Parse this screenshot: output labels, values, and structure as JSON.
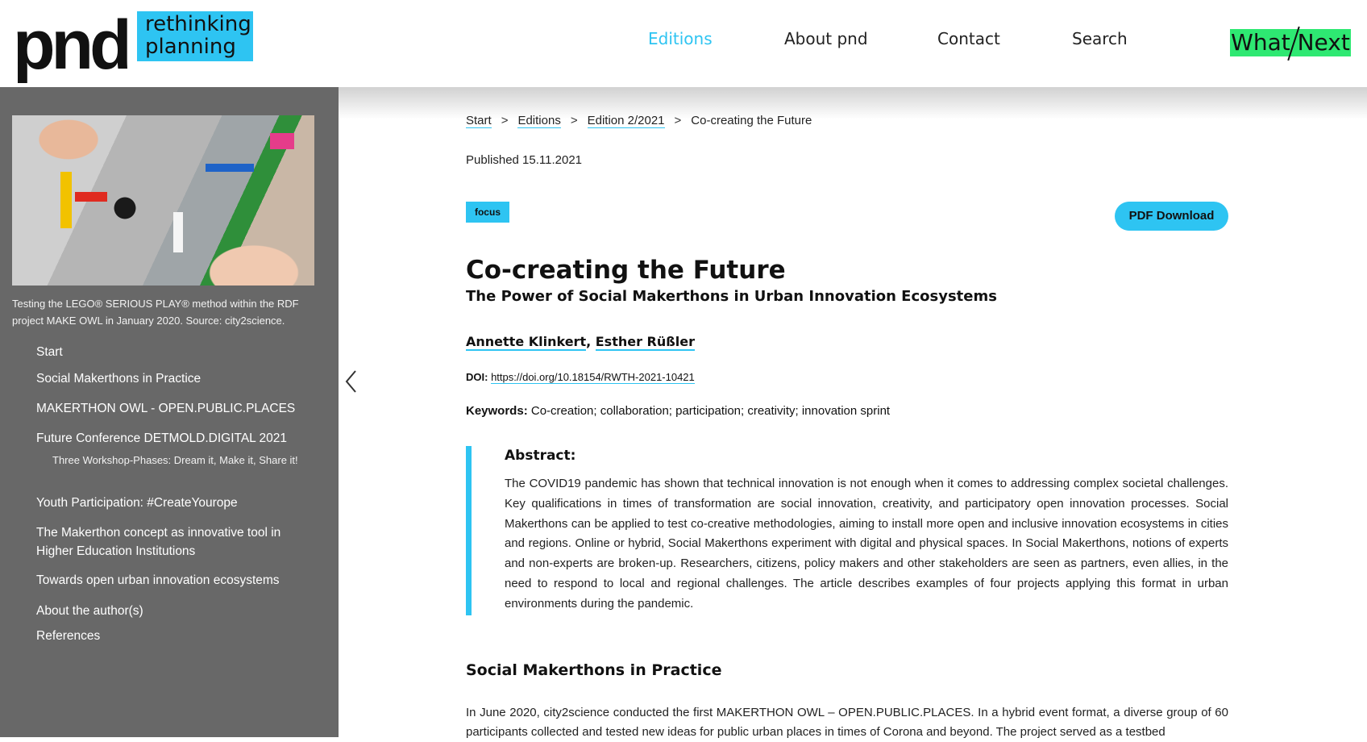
{
  "header": {
    "logo_main": "pnd",
    "logo_box_line1": "rethinking",
    "logo_box_line2": "planning",
    "nav": [
      {
        "label": "Editions",
        "active": true
      },
      {
        "label": "About pnd"
      },
      {
        "label": "Contact"
      },
      {
        "label": "Search"
      }
    ],
    "whatnext": "What Next",
    "accent": "#2ec4f2",
    "whatnext_color": "#2ee872"
  },
  "sidebar": {
    "image_alt": "LEGO SERIOUS PLAY workshop photo",
    "caption": "Testing the LEGO® SERIOUS PLAY® method within the RDF project MAKE OWL in January 2020. Source: city2science.",
    "toc": [
      "Start",
      "Social Makerthons in Practice",
      "MAKERTHON OWL - OPEN.PUBLIC.PLACES",
      "Future Conference DETMOLD.DIGITAL 2021",
      "Youth Participation: #CreateYourope",
      "The Makerthon concept as innovative tool in Higher Education Institutions",
      "Towards open urban innovation ecosystems",
      "About the author(s)",
      "References"
    ],
    "toc_sub": "Three Workshop-Phases: Dream it, Make it, Share it!",
    "background": "#686868"
  },
  "article": {
    "breadcrumbs": [
      "Start",
      "Editions",
      "Edition 2/2021"
    ],
    "breadcrumb_current": "Co-creating the Future",
    "breadcrumb_sep": ">",
    "published": "Published 15.11.2021",
    "tag": "focus",
    "pdf_button": "PDF Download",
    "title": "Co-creating the Future",
    "subtitle": "The Power of Social Makerthons in Urban Innovation Ecosystems",
    "authors": [
      "Annette Klinkert",
      "Esther Rüßler"
    ],
    "doi_label": "DOI:",
    "doi": "https://doi.org/10.18154/RWTH-2021-10421",
    "keywords_label": "Keywords:",
    "keywords": "Co-creation; collaboration; participation; creativity; innovation sprint",
    "abstract_heading": "Abstract:",
    "abstract": "The COVID19 pandemic has shown that technical innovation is not enough when it comes to addressing complex societal challenges. Key qualifications in times of transformation are social innovation, creativity, and participatory open innovation processes. Social Makerthons can be applied to test co-creative methodologies, aiming to install more open and inclusive innovation ecosystems in cities and regions. Online or hybrid, Social Makerthons experiment with digital and physical spaces. In Social Makerthons, notions of experts and non-experts are broken-up. Researchers, citizens, policy makers and other stakeholders are seen as partners, even allies, in the need to respond to local and regional challenges. The article describes examples of four projects applying this format in urban environments during the pandemic.",
    "section_heading": "Social Makerthons in Practice",
    "section_body": "In June 2020, city2science conducted the first MAKERTHON OWL – OPEN.PUBLIC.PLACES. In a hybrid event format, a diverse group of 60 participants collected and tested new ideas for public urban places in times of Corona and beyond. The project served as a testbed"
  }
}
